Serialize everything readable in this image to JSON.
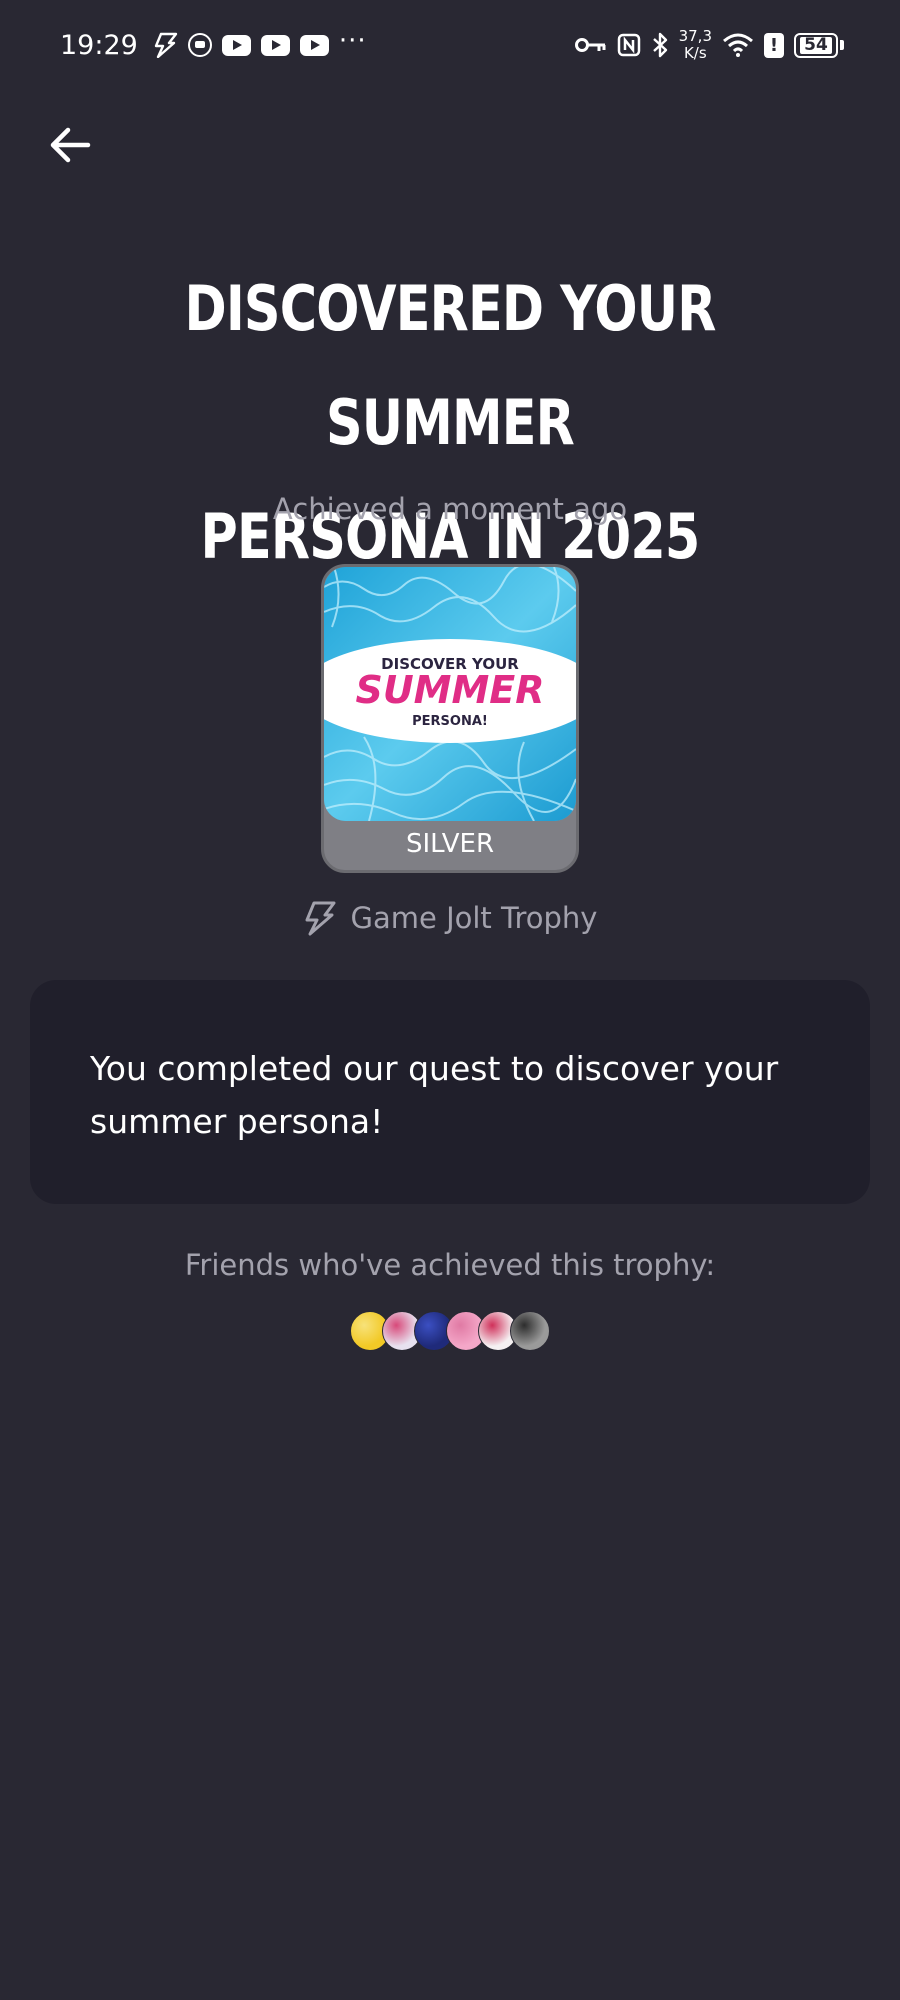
{
  "status_bar": {
    "time": "19:29",
    "network_speed_value": "37,3",
    "network_speed_unit": "K/s",
    "battery_level": "54",
    "icons": [
      "gamejolt-icon",
      "screen-record-icon",
      "youtube-icon",
      "youtube-icon",
      "youtube-icon",
      "more-icon",
      "key-icon",
      "nfc-icon",
      "bluetooth-icon",
      "wifi-icon",
      "alert-icon",
      "battery-icon"
    ]
  },
  "header": {
    "back_icon": "arrow-left-icon"
  },
  "trophy": {
    "title_line1": "DISCOVERED YOUR SUMMER",
    "title_line2": "PERSONA IN 2025",
    "achieved_text": "Achieved a moment ago",
    "image_text_top": "DISCOVER YOUR",
    "image_text_main": "SUMMER",
    "image_text_bottom": "PERSONA!",
    "level": "SILVER",
    "type_label": "Game Jolt Trophy",
    "description": "You completed our quest to discover your summer persona!"
  },
  "friends": {
    "label": "Friends who've achieved this trophy:",
    "avatars": [
      {
        "color": "#f2c926",
        "accent": "#f7e27a"
      },
      {
        "color": "#e7e1ef",
        "accent": "#d84a7a"
      },
      {
        "color": "#1f2a7a",
        "accent": "#3b4fc2"
      },
      {
        "color": "#f4a7c8",
        "accent": "#e07aa4"
      },
      {
        "color": "#f5f0f2",
        "accent": "#d0305a"
      },
      {
        "color": "#9a9a9a",
        "accent": "#2d2d2d"
      }
    ]
  },
  "colors": {
    "background": "#292833",
    "card": "#201f2b",
    "muted_text": "#a3a2ad",
    "silver": "#7f7f85",
    "summer_pink": "#e02d86"
  }
}
